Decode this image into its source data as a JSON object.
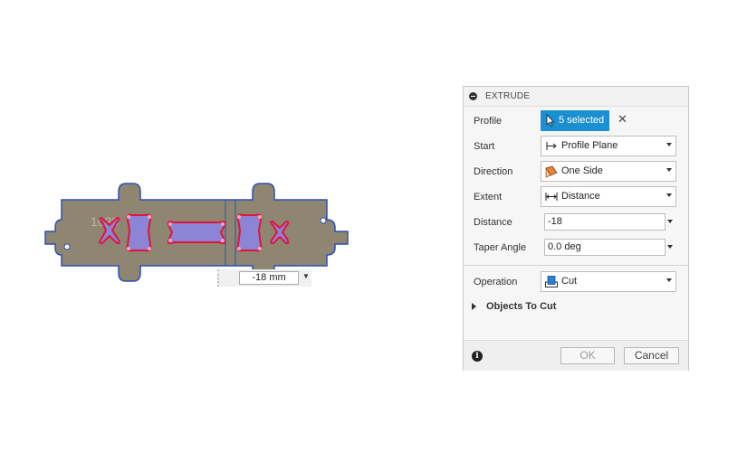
{
  "viewport": {
    "dimension_value": "-18 mm",
    "sketch_text": "1020"
  },
  "panel": {
    "title": "EXTRUDE",
    "profile": {
      "label": "Profile",
      "selection_text": "5 selected"
    },
    "start": {
      "label": "Start",
      "value": "Profile Plane"
    },
    "direction": {
      "label": "Direction",
      "value": "One Side"
    },
    "extent": {
      "label": "Extent",
      "value": "Distance"
    },
    "distance": {
      "label": "Distance",
      "value": "-18"
    },
    "taper": {
      "label": "Taper Angle",
      "value": "0.0 deg"
    },
    "operation": {
      "label": "Operation",
      "value": "Cut"
    },
    "objects_to_cut": {
      "label": "Objects To Cut"
    },
    "ok_label": "OK",
    "cancel_label": "Cancel"
  },
  "colors": {
    "accent": "#1a8fd1",
    "body_fill": "#8f8672",
    "body_outline": "#2a4fb5",
    "profile_fill": "#8c84d4",
    "profile_outline": "#e0143c"
  }
}
